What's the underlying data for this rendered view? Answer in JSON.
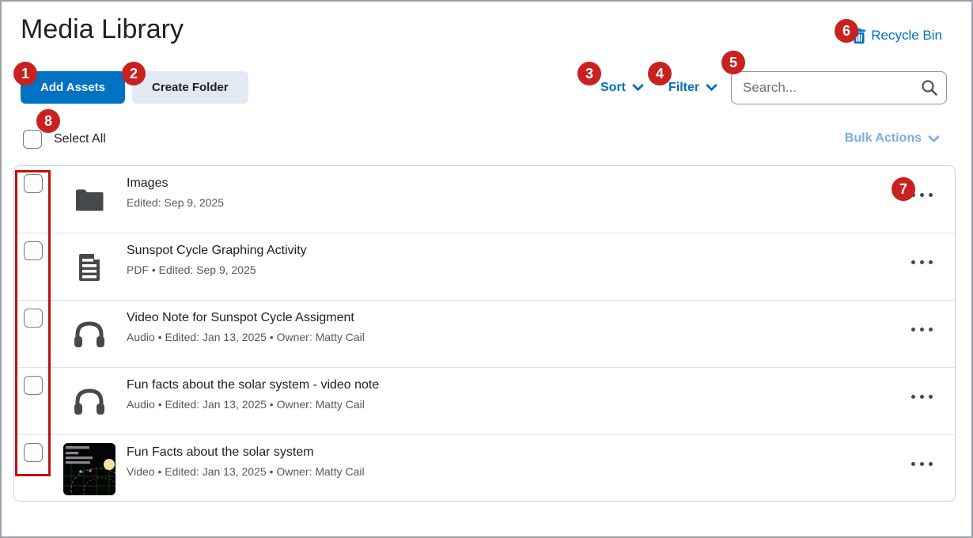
{
  "page": {
    "title": "Media Library"
  },
  "header": {
    "recycle_bin_label": "Recycle Bin"
  },
  "toolbar": {
    "add_assets_label": "Add Assets",
    "create_folder_label": "Create Folder",
    "sort_label": "Sort",
    "filter_label": "Filter",
    "search_placeholder": "Search...",
    "search_value": ""
  },
  "selection_bar": {
    "select_all_label": "Select All",
    "bulk_actions_label": "Bulk Actions"
  },
  "list": {
    "items": [
      {
        "icon": "folder-icon",
        "title": "Images",
        "meta": "Edited: Sep 9, 2025"
      },
      {
        "icon": "document-icon",
        "title": "Sunspot Cycle Graphing Activity",
        "meta": "PDF  •  Edited: Sep 9, 2025"
      },
      {
        "icon": "headphones-icon",
        "title": "Video Note for Sunspot Cycle Assigment",
        "meta": "Audio  •  Edited: Jan 13, 2025  •  Owner: Matty Cail"
      },
      {
        "icon": "headphones-icon",
        "title": "Fun facts about the solar system - video note",
        "meta": "Audio  •  Edited: Jan 13, 2025  •  Owner: Matty Cail"
      },
      {
        "icon": "video-thumbnail",
        "title": "Fun Facts about the solar system",
        "meta": "Video  •  Edited: Jan 13, 2025  •  Owner: Matty Cail"
      }
    ]
  },
  "annotations": {
    "steps": [
      "1",
      "2",
      "3",
      "4",
      "5",
      "6",
      "7",
      "8"
    ]
  },
  "colors": {
    "accent_blue": "#006fbf",
    "primary_button_blue": "#0072c3",
    "disabled_link_blue": "#7cb0de",
    "badge_red": "#c92020",
    "highlight_red": "#c30f0f",
    "text_dark": "#202122",
    "text_meta_gray": "#56595b"
  }
}
